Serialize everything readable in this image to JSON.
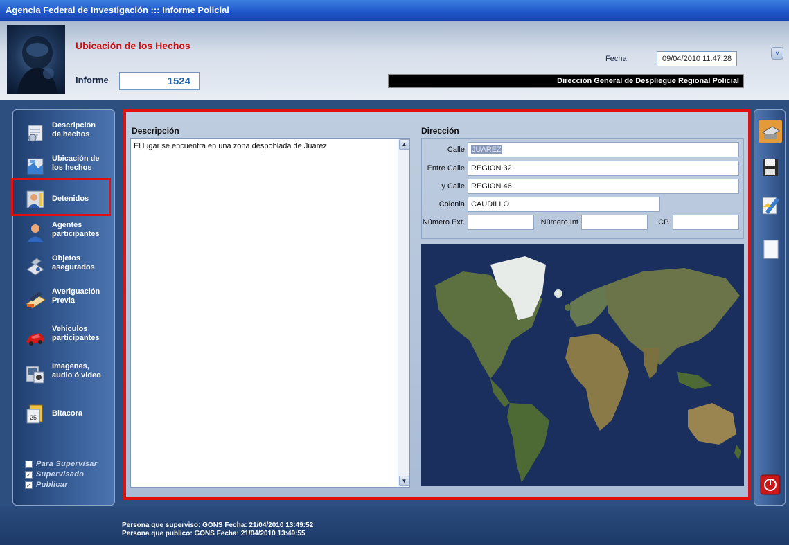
{
  "window": {
    "title": "Agencia Federal de Investigación ::: Informe Policial"
  },
  "header": {
    "section_title": "Ubicación de los Hechos",
    "informe_label": "Informe",
    "informe_value": "1524",
    "fecha_label": "Fecha",
    "fecha_value": "09/04/2010 11:47:28",
    "department": "Dirección General de Despliegue Regional Policial"
  },
  "sidebar": {
    "items": [
      {
        "label": "Descripción\nde hechos",
        "icon": "document-icon"
      },
      {
        "label": "Ubicación de\nlos hechos",
        "icon": "map-location-icon"
      },
      {
        "label": "Detenidos",
        "icon": "detainee-icon"
      },
      {
        "label": "Agentes\nparticipantes",
        "icon": "agent-icon"
      },
      {
        "label": "Objetos\nasegurados",
        "icon": "secured-objects-icon"
      },
      {
        "label": "Averiguación\nPrevia",
        "icon": "inquiry-icon"
      },
      {
        "label": "Vehiculos\nparticipantes",
        "icon": "car-icon"
      },
      {
        "label": "Imagenes,\naudio ó video",
        "icon": "media-icon"
      },
      {
        "label": "Bitacora",
        "icon": "calendar-icon"
      }
    ],
    "checks": [
      {
        "label": "Para Supervisar",
        "checked": false
      },
      {
        "label": "Supervisado",
        "checked": true
      },
      {
        "label": "Publicar",
        "checked": true
      }
    ]
  },
  "descripcion": {
    "label": "Descripción",
    "text": "El lugar se encuentra en una zona despoblada de Juarez"
  },
  "direccion": {
    "label": "Dirección",
    "calle_label": "Calle",
    "calle_value": "JUAREZ",
    "entre_label": "Entre Calle",
    "entre_value": "REGION 32",
    "ycalle_label": "y Calle",
    "ycalle_value": "REGION 46",
    "colonia_label": "Colonia",
    "colonia_value": "CAUDILLO",
    "num_ext_label": "Número Ext.",
    "num_ext_value": "",
    "num_int_label": "Número Int",
    "num_int_value": "",
    "cp_label": "CP.",
    "cp_value": ""
  },
  "toolbar": {
    "buttons": [
      "printer-icon",
      "save-icon",
      "edit-icon",
      "new-page-icon",
      "exit-icon"
    ]
  },
  "footer": {
    "supervisor_line": "Persona que superviso: GONS   Fecha: 21/04/2010  13:49:52",
    "publisher_line": "Persona que publico: GONS   Fecha: 21/04/2010  13:49:55"
  },
  "colors": {
    "title_bar": "#1f55c8",
    "highlight": "#e01010",
    "section_title": "#d01010"
  }
}
